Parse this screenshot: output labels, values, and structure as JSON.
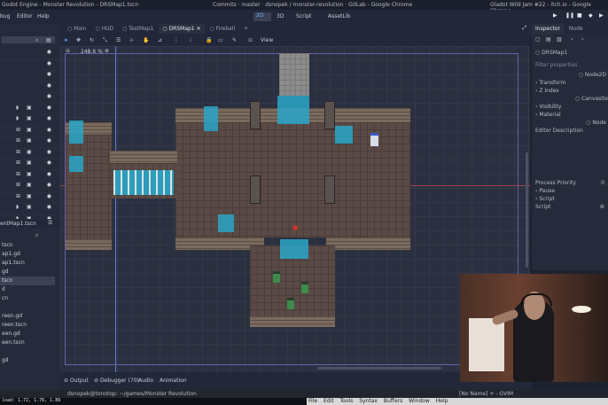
{
  "window": {
    "title": "Godot Engine - Monster Revolution - DRSMap1.tscn",
    "browser_title_1": "Commits · master · dsnopek / monster-revolution · GitLab - Google Chrome",
    "browser_title_2": "Gladot Wild Jam #22 - itch.io - Google Chrome"
  },
  "menu": {
    "debug": "bug",
    "editor": "Editor",
    "help": "Help",
    "mode_2d": "2D",
    "mode_3d": "3D",
    "mode_script": "Script",
    "mode_assetlib": "AssetLib"
  },
  "scene_tabs": [
    "Main",
    "HUD",
    "TestMap1",
    "DRSMap1",
    "Fireball"
  ],
  "viewport": {
    "zoom": "248.6 %",
    "view_label": "View"
  },
  "filesystem": {
    "path_label": "entMap1.tscn",
    "files": [
      "tscn",
      "ap1.gd",
      "ap1.tscn",
      "gd",
      "tscn",
      "d",
      "cn",
      "",
      "reen.gd",
      "reen.tscn",
      "een.gd",
      "een.tscn",
      "",
      "gd"
    ]
  },
  "inspector": {
    "tab_inspector": "Inspector",
    "tab_node": "Node",
    "node_name": "DRSMap1",
    "filter_placeholder": "Filter properties",
    "type_node2d": "Node2D",
    "transform": "Transform",
    "z_index": "Z Index",
    "canvas_item": "CanvasIte",
    "visibility": "Visibility",
    "material": "Material",
    "node": "Node",
    "editor_description": "Editor Description",
    "process_priority_label": "Process Priority",
    "process_priority_value": "0",
    "pause": "Pause",
    "script_section": "Script",
    "script_label": "Script"
  },
  "bottom_panel": {
    "output": "Output",
    "debugger": "Debugger (70)",
    "audio": "Audio",
    "animation": "Animation"
  },
  "terminal": {
    "prompt": "dsnopek@tonotop: ~/games/Monster Revolution",
    "load": "load: 1.72, 1.76, 1.89",
    "vim_title": "[No Name] + - GVIM",
    "vim_menu": [
      "File",
      "Edit",
      "Tools",
      "Syntax",
      "Buffers",
      "Window",
      "Help"
    ]
  },
  "colors": {
    "accent": "#6fa8f5",
    "water": "#2aa6c8",
    "floor": "#5a4a46",
    "panel": "#252b3b"
  }
}
